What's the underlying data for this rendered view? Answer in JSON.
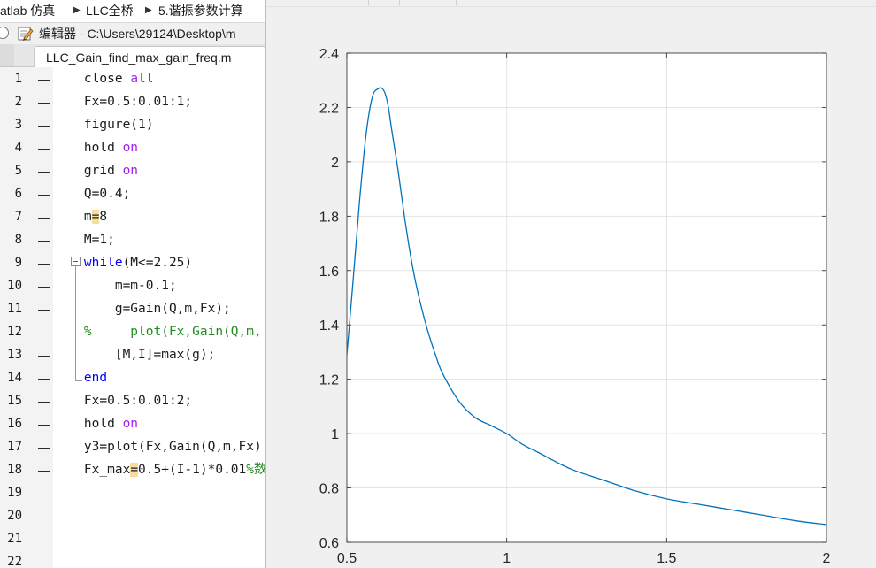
{
  "breadcrumb": {
    "items": [
      "atlab 仿真",
      "LLC全桥",
      "5.谐振参数计算"
    ]
  },
  "editor": {
    "title": "编辑器 - C:\\Users\\29124\\Desktop\\m",
    "tab": "LLC_Gain_find_max_gain_freq.m",
    "lines": [
      {
        "n": "1",
        "dash": "—",
        "tokens": [
          {
            "t": "    close "
          },
          {
            "t": "all",
            "c": "str"
          }
        ]
      },
      {
        "n": "2",
        "dash": "—",
        "tokens": [
          {
            "t": "    Fx=0.5:0.01:1;"
          }
        ]
      },
      {
        "n": "3",
        "dash": "—",
        "tokens": [
          {
            "t": "    figure(1)"
          }
        ]
      },
      {
        "n": "4",
        "dash": "—",
        "tokens": [
          {
            "t": "    hold "
          },
          {
            "t": "on",
            "c": "str"
          }
        ]
      },
      {
        "n": "5",
        "dash": "—",
        "tokens": [
          {
            "t": "    grid "
          },
          {
            "t": "on",
            "c": "str"
          }
        ]
      },
      {
        "n": "6",
        "dash": "—",
        "tokens": [
          {
            "t": "    Q=0.4;"
          }
        ]
      },
      {
        "n": "7",
        "dash": "—",
        "tokens": [
          {
            "t": "    m"
          },
          {
            "t": "=",
            "c": "hl"
          },
          {
            "t": "8"
          }
        ]
      },
      {
        "n": "8",
        "dash": "—",
        "tokens": [
          {
            "t": "    M=1;"
          }
        ]
      },
      {
        "n": "9",
        "dash": "—",
        "tokens": [
          {
            "t": "    "
          },
          {
            "t": "while",
            "c": "kw"
          },
          {
            "t": "(M<=2.25)"
          }
        ]
      },
      {
        "n": "10",
        "dash": "—",
        "tokens": [
          {
            "t": "        m=m-0.1;"
          }
        ]
      },
      {
        "n": "11",
        "dash": "—",
        "tokens": [
          {
            "t": "        g=Gain(Q,m,Fx);"
          }
        ]
      },
      {
        "n": "12",
        "dash": "",
        "tokens": [
          {
            "t": "    %     plot(Fx,Gain(Q,m,",
            "c": "cm"
          }
        ]
      },
      {
        "n": "13",
        "dash": "—",
        "tokens": [
          {
            "t": "        [M,I]=max(g);"
          }
        ]
      },
      {
        "n": "14",
        "dash": "—",
        "tokens": [
          {
            "t": "    "
          },
          {
            "t": "end",
            "c": "kw"
          }
        ]
      },
      {
        "n": "15",
        "dash": "—",
        "tokens": [
          {
            "t": "    Fx=0.5:0.01:2;"
          }
        ]
      },
      {
        "n": "16",
        "dash": "—",
        "tokens": [
          {
            "t": "    hold "
          },
          {
            "t": "on",
            "c": "str"
          }
        ]
      },
      {
        "n": "17",
        "dash": "—",
        "tokens": [
          {
            "t": "    y3=plot(Fx,Gain(Q,m,Fx)"
          }
        ]
      },
      {
        "n": "18",
        "dash": "—",
        "tokens": [
          {
            "t": "    Fx_max"
          },
          {
            "t": "=",
            "c": "hl"
          },
          {
            "t": "0.5+(I-1)*0.01"
          },
          {
            "t": "%数",
            "c": "cm"
          }
        ]
      },
      {
        "n": "19",
        "dash": "",
        "tokens": []
      },
      {
        "n": "20",
        "dash": "",
        "tokens": []
      },
      {
        "n": "21",
        "dash": "",
        "tokens": []
      },
      {
        "n": "22",
        "dash": "",
        "tokens": []
      }
    ]
  },
  "colors": {
    "keyword": "#0000ff",
    "string": "#a020f0",
    "comment": "#228b22",
    "highlight": "#f5dea0",
    "series": "#0072bd",
    "grid": "#e3e3e3"
  },
  "chart_data": {
    "type": "line",
    "title": "",
    "xlabel": "",
    "ylabel": "",
    "xlim": [
      0.5,
      2
    ],
    "ylim": [
      0.6,
      2.4
    ],
    "xticks": [
      "0.5",
      "1",
      "1.5",
      "2"
    ],
    "yticks": [
      "0.6",
      "0.8",
      "1",
      "1.2",
      "1.4",
      "1.6",
      "1.8",
      "2",
      "2.2",
      "2.4"
    ],
    "grid": true,
    "series": [
      {
        "x": [
          0.5,
          0.52,
          0.54,
          0.56,
          0.58,
          0.6,
          0.61,
          0.62,
          0.63,
          0.64,
          0.66,
          0.68,
          0.7,
          0.72,
          0.75,
          0.78,
          0.8,
          0.85,
          0.9,
          0.95,
          1.0,
          1.05,
          1.1,
          1.2,
          1.3,
          1.4,
          1.5,
          1.6,
          1.7,
          1.8,
          1.9,
          2.0
        ],
        "y": [
          1.29,
          1.57,
          1.86,
          2.1,
          2.24,
          2.27,
          2.27,
          2.25,
          2.2,
          2.12,
          1.97,
          1.8,
          1.65,
          1.53,
          1.39,
          1.28,
          1.22,
          1.12,
          1.06,
          1.03,
          1.0,
          0.96,
          0.93,
          0.87,
          0.83,
          0.79,
          0.76,
          0.74,
          0.72,
          0.7,
          0.68,
          0.665
        ]
      }
    ]
  }
}
